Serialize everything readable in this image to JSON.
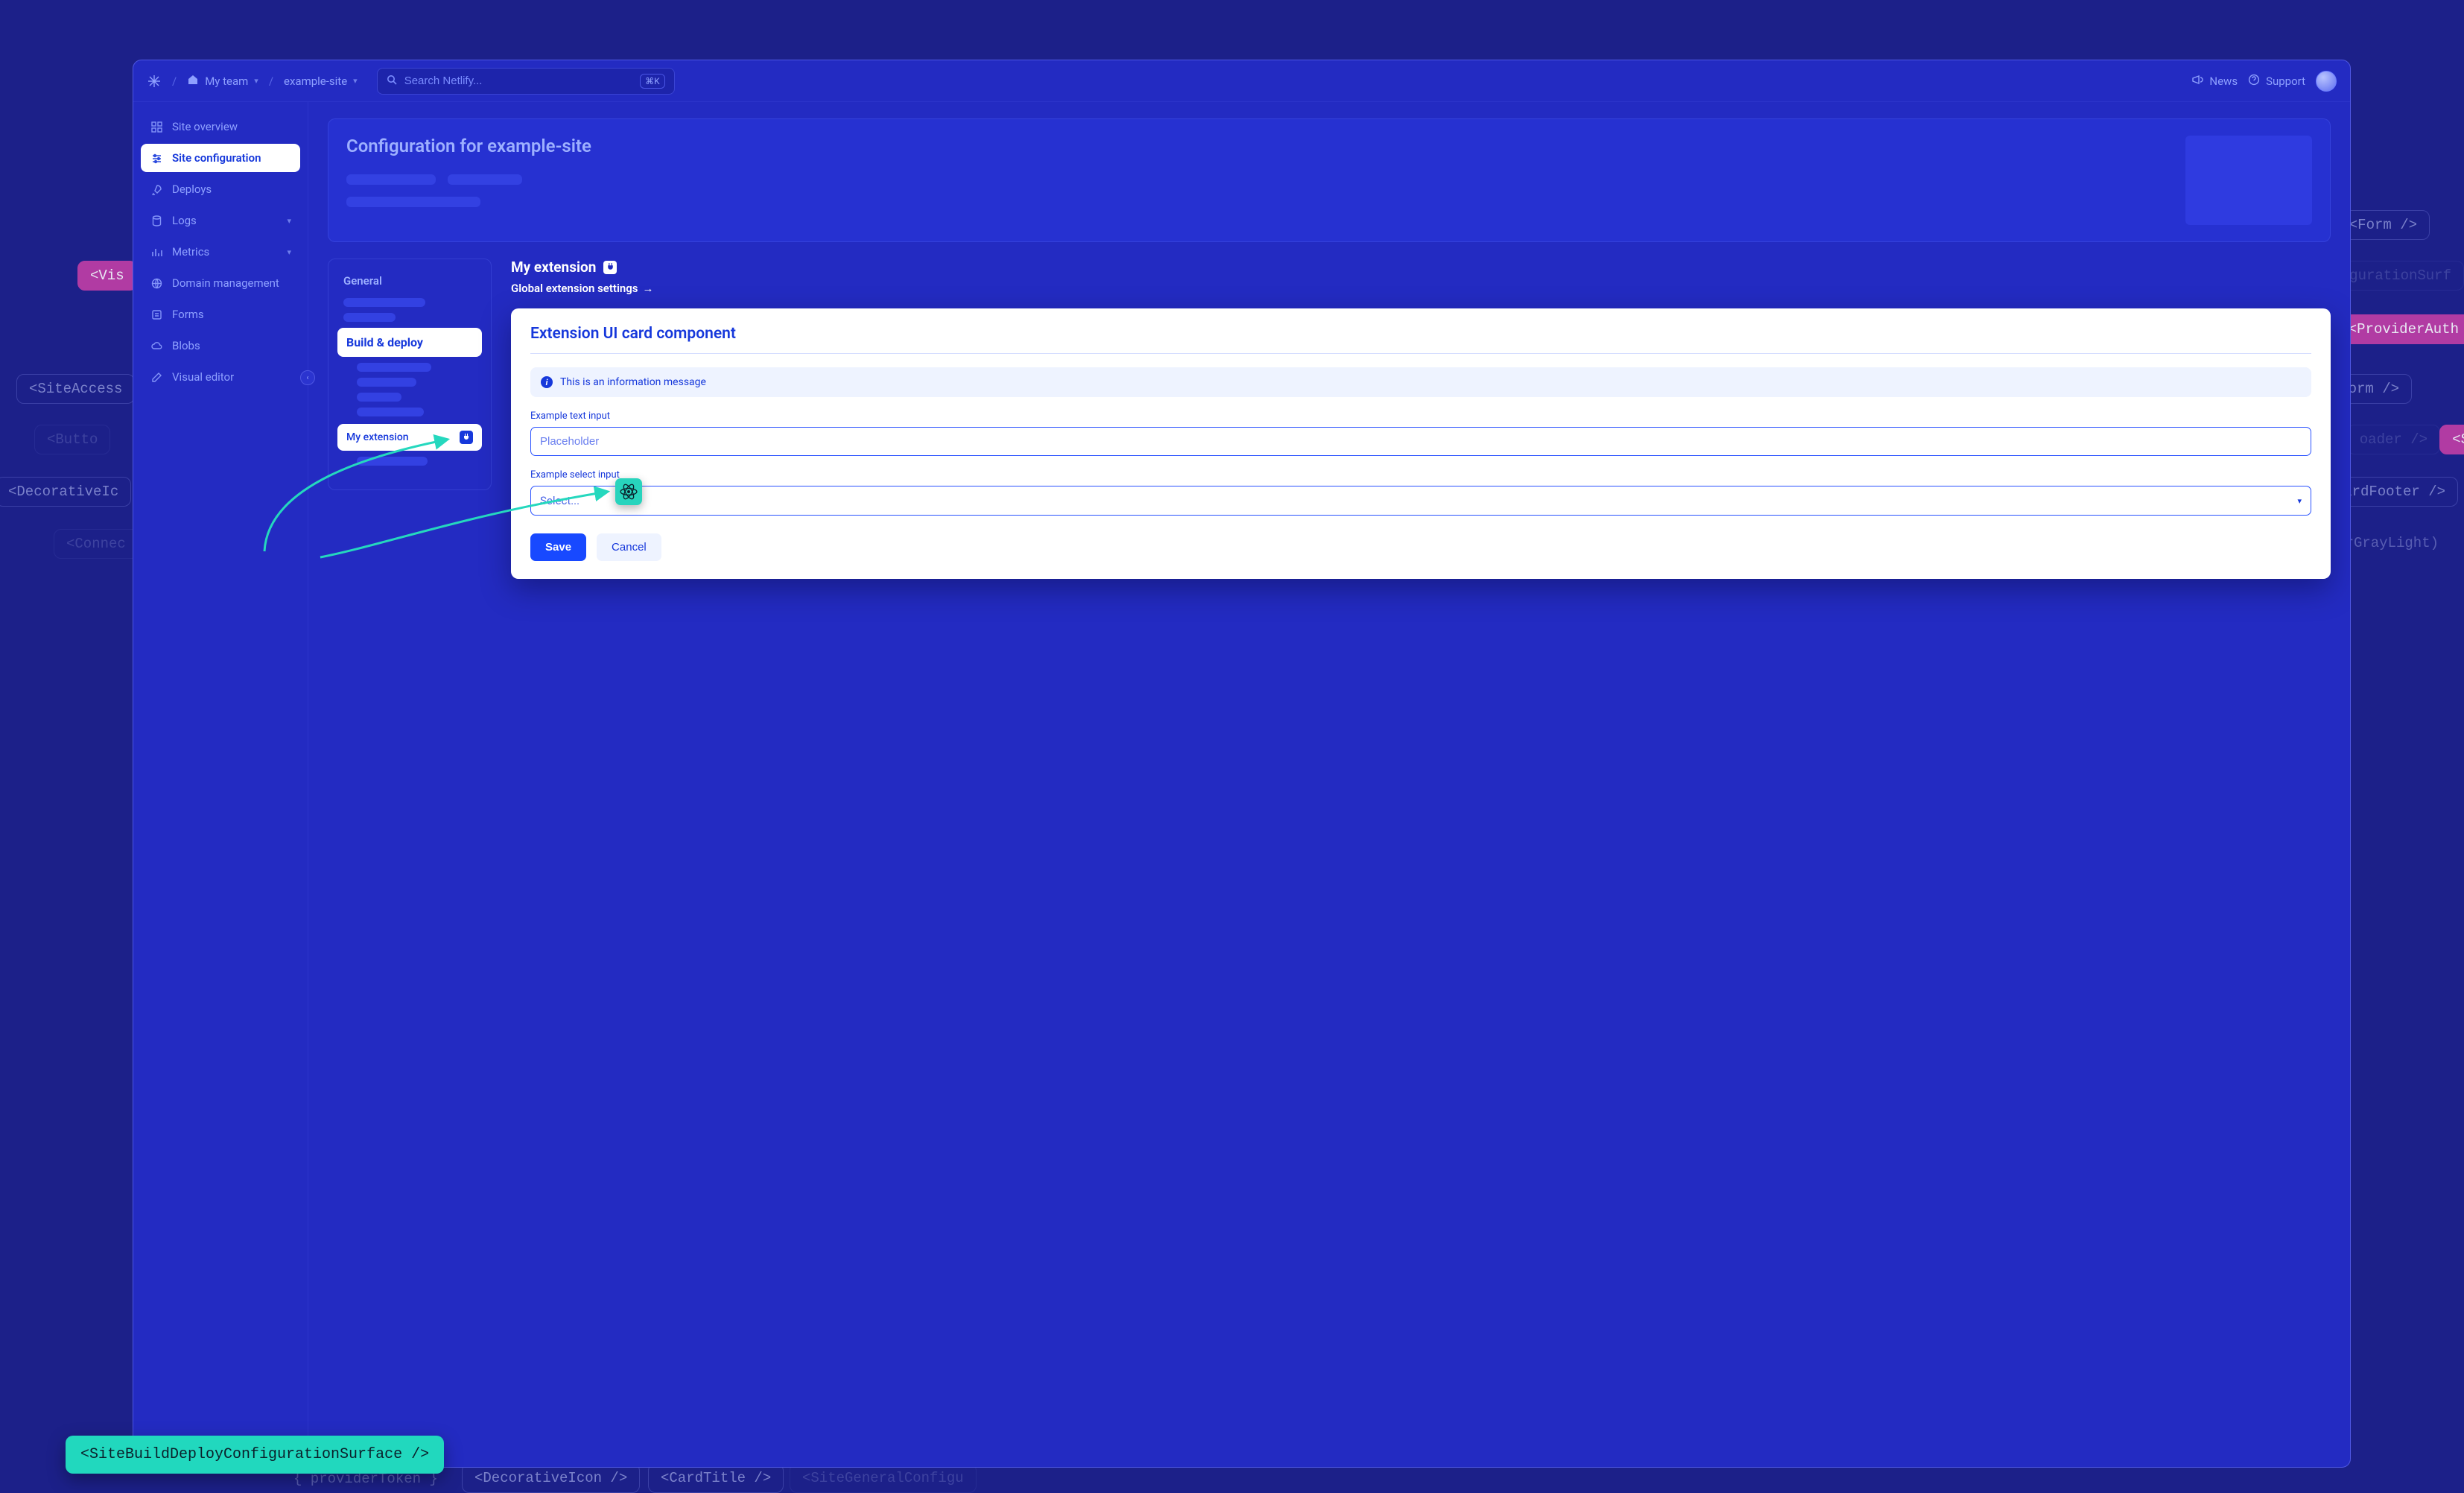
{
  "topbar": {
    "team_label": "My team",
    "site_label": "example-site",
    "search_placeholder": "Search Netlify...",
    "kbd_shortcut": "⌘K",
    "news_label": "News",
    "support_label": "Support"
  },
  "sidebar": {
    "items": [
      {
        "label": "Site overview"
      },
      {
        "label": "Site configuration"
      },
      {
        "label": "Deploys"
      },
      {
        "label": "Logs"
      },
      {
        "label": "Metrics"
      },
      {
        "label": "Domain management"
      },
      {
        "label": "Forms"
      },
      {
        "label": "Blobs"
      },
      {
        "label": "Visual editor"
      }
    ]
  },
  "hero": {
    "title": "Configuration for example-site"
  },
  "subnav": {
    "general_label": "General",
    "build_deploy_label": "Build & deploy",
    "my_extension_label": "My extension"
  },
  "extension": {
    "title": "My extension",
    "settings_link": "Global extension settings",
    "arrow": "→"
  },
  "card": {
    "title": "Extension UI card component",
    "info_message": "This is an information message",
    "text_label": "Example text input",
    "text_placeholder": "Placeholder",
    "select_label": "Example select input",
    "select_placeholder": "Select...",
    "save_label": "Save",
    "cancel_label": "Cancel"
  },
  "callout": {
    "code": "<SiteBuildDeployConfigurationSurface />"
  },
  "bg_snippets": {
    "form1": "<Form />",
    "form2": "<Form />",
    "visual": "<Vis",
    "fig_surf": "figurationSurf",
    "provider_auth": "<ProviderAuth",
    "site_access": "<SiteAccess",
    "button": "<Butto",
    "decorative1": "<DecorativeIc",
    "loader": "oader />",
    "s_frag": "<S",
    "card_footer": "ardFooter />",
    "gray_light": "rGrayLight)",
    "connec": "<Connec",
    "provider_token": "{ providerToken }",
    "decorative2": "<DecorativeIcon />",
    "card_title": "<CardTitle />",
    "site_general": "<SiteGeneralConfigu"
  }
}
